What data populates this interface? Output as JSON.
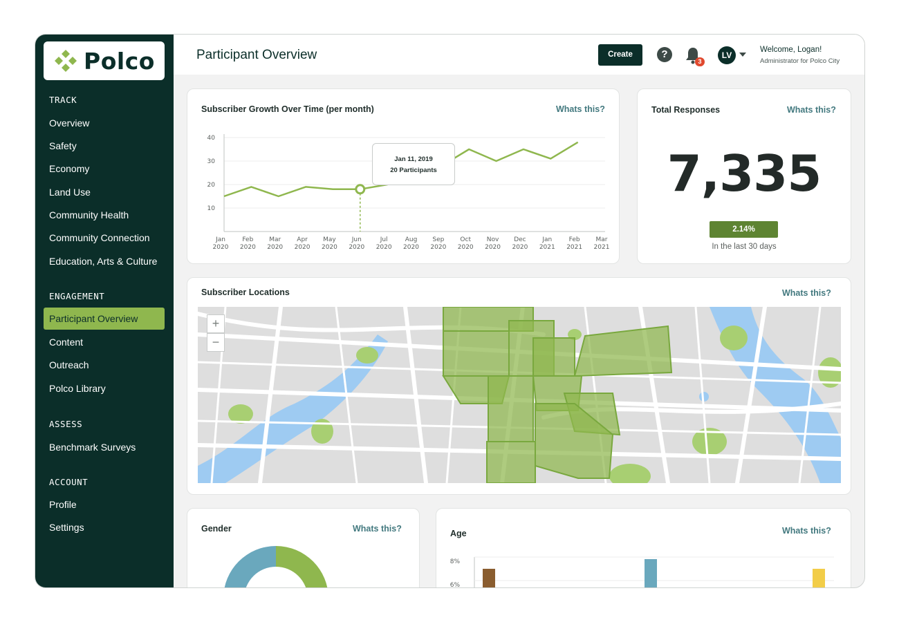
{
  "app": {
    "logo": "Polco"
  },
  "header": {
    "title": "Participant Overview",
    "create_label": "Create",
    "help_symbol": "?",
    "notifications_count": "3",
    "avatar_initials": "LV",
    "welcome": "Welcome, Logan!",
    "welcome_sub": "Administrator for Polco City"
  },
  "sidebar": {
    "sections": [
      {
        "title": "TRACK",
        "items": [
          "Overview",
          "Safety",
          "Economy",
          "Land Use",
          "Community Health",
          "Community Connection",
          "Education, Arts & Culture"
        ]
      },
      {
        "title": "ENGAGEMENT",
        "items": [
          "Participant Overview",
          "Content",
          "Outreach",
          "Polco Library"
        ]
      },
      {
        "title": "ASSESS",
        "items": [
          "Benchmark Surveys"
        ]
      },
      {
        "title": "ACCOUNT",
        "items": [
          "Profile",
          "Settings"
        ]
      }
    ],
    "active_item": "Participant Overview"
  },
  "cards": {
    "growth": {
      "title": "Subscriber Growth Over Time (per month)",
      "whats": "Whats this?",
      "tooltip_date": "Jan 11, 2019",
      "tooltip_value": "20 Participants"
    },
    "total": {
      "title": "Total Responses",
      "whats": "Whats this?",
      "value": "7,335",
      "change": "2.14%",
      "change_label": "In the last 30 days"
    },
    "locations": {
      "title": "Subscriber Locations",
      "whats": "Whats this?",
      "zoom_in": "+",
      "zoom_out": "−"
    },
    "gender": {
      "title": "Gender",
      "whats": "Whats this?"
    },
    "age": {
      "title": "Age",
      "whats": "Whats this?"
    }
  },
  "colors": {
    "sidebar_bg": "#0b2e29",
    "accent_green": "#8fb74e",
    "line_green": "#8fb74e",
    "link_teal": "#43797f",
    "badge_green": "#5e8432",
    "gender_blue": "#6aa8bd",
    "gender_green": "#8fb74e",
    "age_brown": "#8a5d2f",
    "age_blue": "#6aa8bd",
    "age_yellow": "#f2cd48"
  },
  "chart_data": [
    {
      "type": "line",
      "title": "Subscriber Growth Over Time (per month)",
      "x": [
        "Jan 2020",
        "Feb 2020",
        "Mar 2020",
        "Apr 2020",
        "May 2020",
        "Jun 2020",
        "Jul 2020",
        "Aug 2020",
        "Sep 2020",
        "Oct 2020",
        "Nov 2020",
        "Dec 2020",
        "Jan 2021",
        "Feb 2021",
        "Mar 2021"
      ],
      "series": [
        {
          "values": [
            15,
            19,
            15,
            19,
            18,
            18,
            20,
            26,
            28,
            35,
            30,
            35,
            31,
            38,
            null
          ]
        }
      ],
      "yticks": [
        10,
        20,
        30,
        40
      ],
      "ylim": [
        0,
        40
      ],
      "highlight_index": 5,
      "tooltip": {
        "date": "Jan 11, 2019",
        "value": "20 Participants"
      }
    },
    {
      "type": "pie",
      "title": "Gender",
      "slices": [
        {
          "value": 50,
          "color": "#8fb74e"
        },
        {
          "value": 50,
          "color": "#6aa8bd"
        }
      ]
    },
    {
      "type": "bar",
      "title": "Age",
      "yticks": [
        "8%",
        "6%"
      ],
      "values": [
        7.3,
        8.0,
        7.3
      ],
      "colors": [
        "#8a5d2f",
        "#6aa8bd",
        "#f2cd48"
      ]
    }
  ]
}
